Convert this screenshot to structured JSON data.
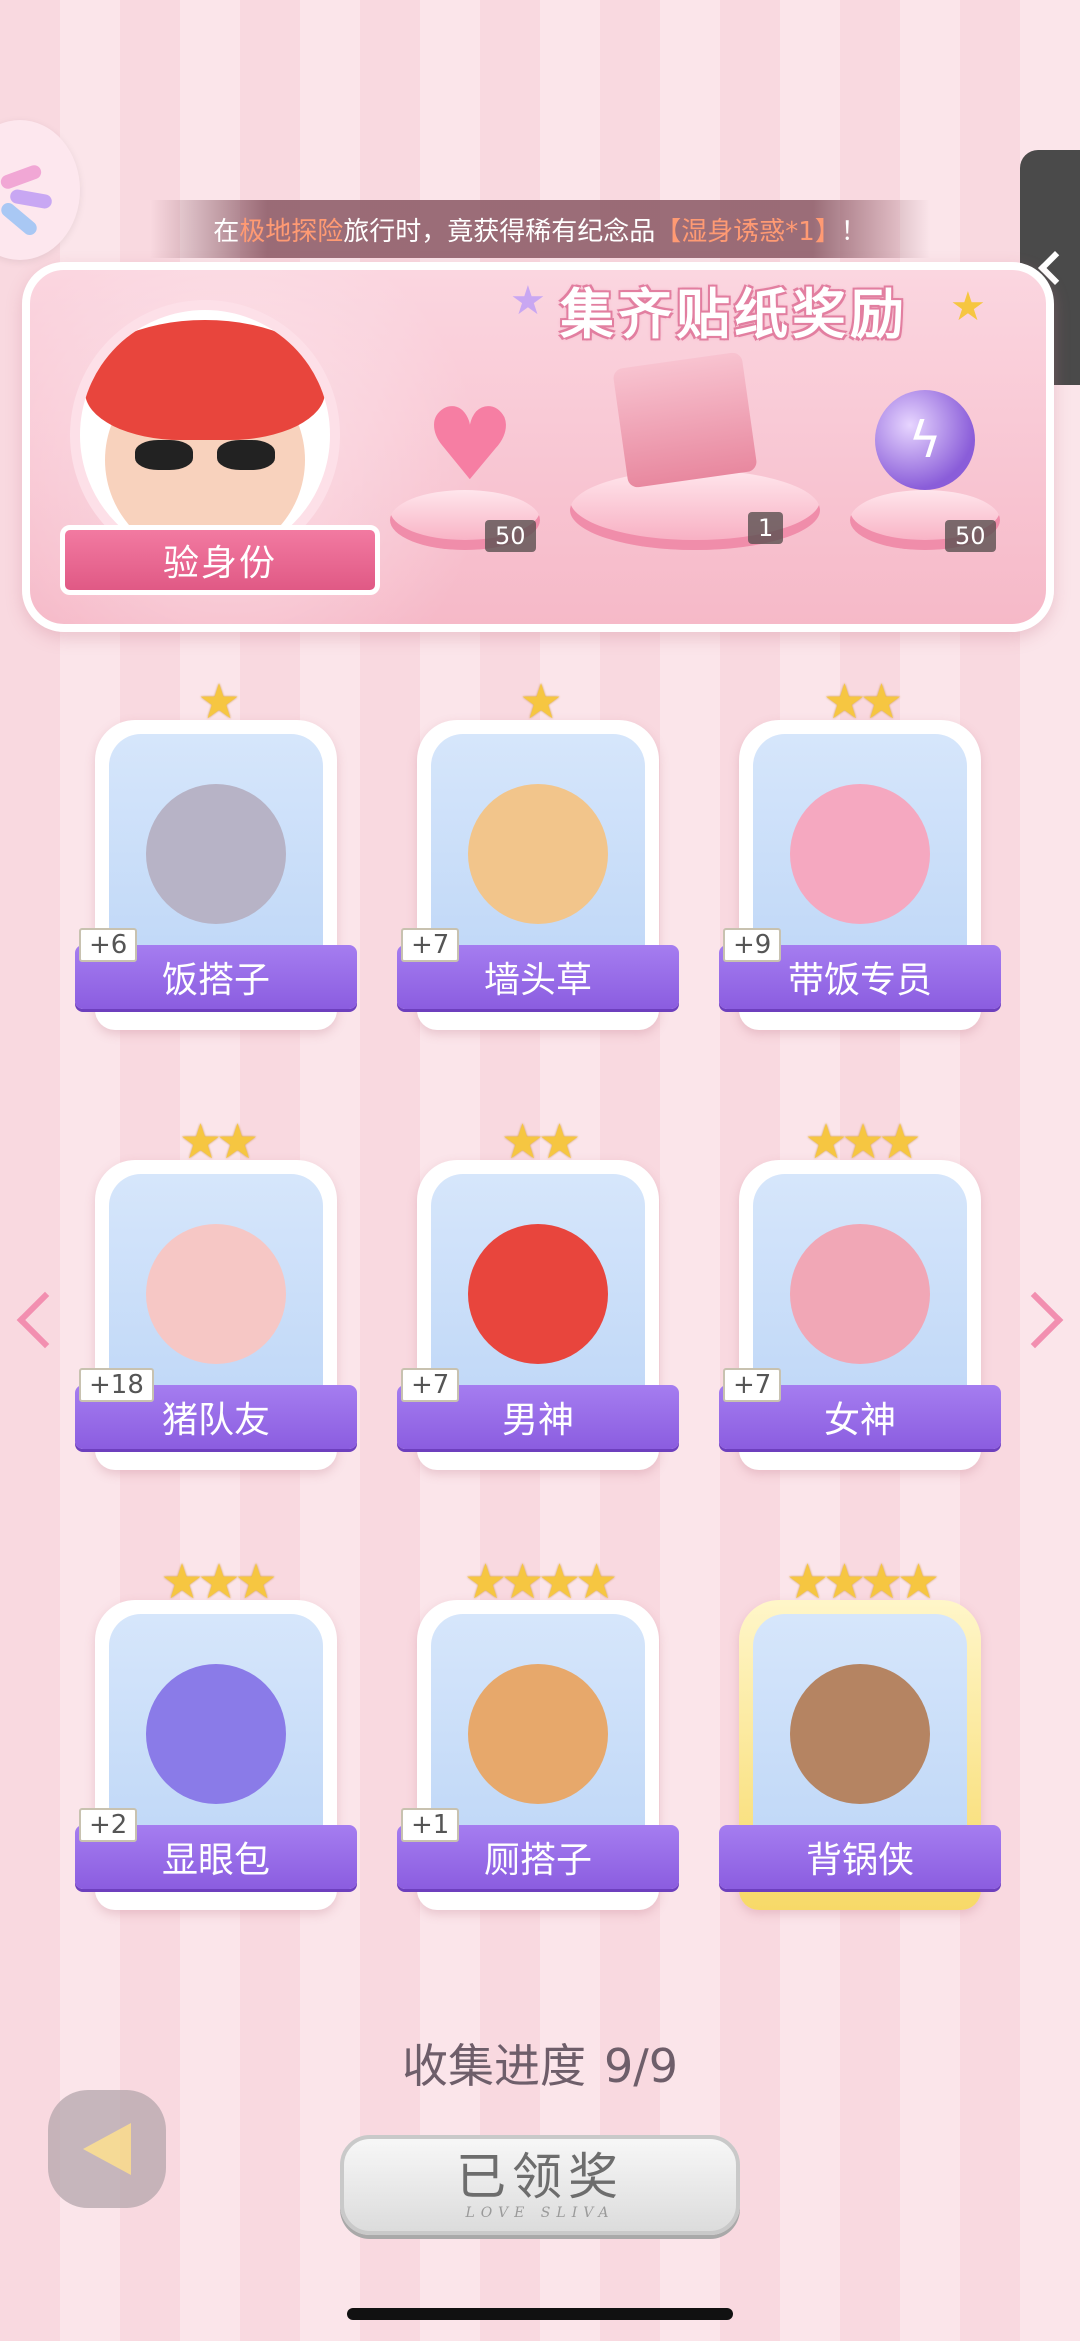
{
  "notice": {
    "prefix": "在",
    "place": "极地探险",
    "middle": "旅行时，竟获得稀有纪念品",
    "item": "【湿身诱惑*1】",
    "suffix": "！"
  },
  "reward_panel": {
    "title": "集齐贴纸奖励",
    "verify_label": "验身份",
    "rewards": [
      {
        "name": "heart-gem",
        "count": "50"
      },
      {
        "name": "gift-box",
        "count": "1"
      },
      {
        "name": "lightning-orb",
        "count": "50"
      }
    ]
  },
  "cards": [
    {
      "stars": "★",
      "label": "饭搭子",
      "plus": "+6"
    },
    {
      "stars": "★",
      "label": "墙头草",
      "plus": "+7"
    },
    {
      "stars": "★★",
      "label": "带饭专员",
      "plus": "+9"
    },
    {
      "stars": "★★",
      "label": "猪队友",
      "plus": "+18"
    },
    {
      "stars": "★★",
      "label": "男神",
      "plus": "+7"
    },
    {
      "stars": "★★★",
      "label": "女神",
      "plus": "+7"
    },
    {
      "stars": "★★★",
      "label": "显眼包",
      "plus": "+2"
    },
    {
      "stars": "★★★★",
      "label": "厕搭子",
      "plus": "+1"
    },
    {
      "stars": "★★★★",
      "label": "背锅侠",
      "plus": ""
    }
  ],
  "progress": {
    "label": "收集进度",
    "value": "9/9"
  },
  "claim_button": {
    "label": "已领奖",
    "sub": "LOVE SLIVA"
  },
  "colors": {
    "accent_purple": "#8b5de0",
    "accent_pink": "#e05985",
    "star": "#f6c641"
  }
}
